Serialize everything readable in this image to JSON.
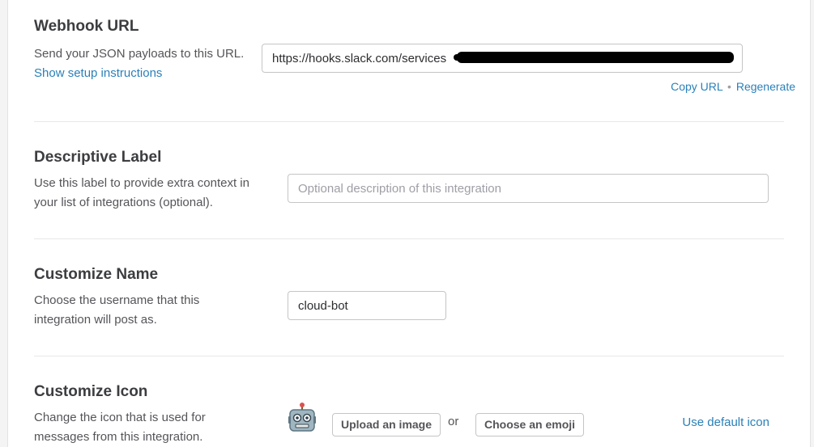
{
  "webhook": {
    "title": "Webhook URL",
    "description": "Send your JSON payloads to this URL.",
    "setup_link": "Show setup instructions",
    "url_value": "https://hooks.slack.com/services",
    "copy_url": "Copy URL",
    "separator": "•",
    "regenerate": "Regenerate"
  },
  "label": {
    "title": "Descriptive Label",
    "description": "Use this label to provide extra context in your list of integrations (optional).",
    "placeholder": "Optional description of this integration",
    "value": ""
  },
  "name": {
    "title": "Customize Name",
    "description": "Choose the username that this integration will post as.",
    "value": "cloud-bot"
  },
  "icon": {
    "title": "Customize Icon",
    "description": "Change the icon that is used for messages from this integration.",
    "current_icon": "robot-icon",
    "upload_button": "Upload an image",
    "or_text": "or",
    "emoji_button": "Choose an emoji",
    "default_link": "Use default icon"
  },
  "colors": {
    "link": "#2a80b9",
    "text": "#2c2d30",
    "muted": "#555459",
    "border": "#c5c5c5"
  }
}
